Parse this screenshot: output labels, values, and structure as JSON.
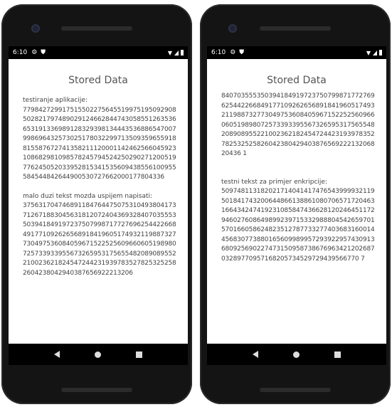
{
  "left": {
    "status": {
      "time": "6:10"
    },
    "title": "Stored Data",
    "sections": [
      {
        "label": "testiranje aplikacije:",
        "value": "779842729917515502275645519975195092908502821797489029124662844743058551263536653191336989128329398134443536886547007998696432573025178032299713509359655918815587672741358211120001142462566045923108682981098578245794524250290271200519776245052033952815341535609438556100955584544842644900530727662000177804336"
      },
      {
        "label": "malo duzi tekst mozda uspijem napisati:",
        "value": "3756317047468911847644750753104938041737126718830456318120724043693284070355535039418491972375079987177276962544226684917710926265689184196051749321198873277304975360840596715225256096606051989807257339339556732659531756554820890895522100236218245472442319397835278253252582604238042940387656922213206"
      }
    ]
  },
  "right": {
    "status": {
      "time": "6:10"
    },
    "title": "Stored Data",
    "sections": [
      {
        "label": "",
        "value": "84070355535039418491972375079987177276962544226684917710926265689184196051749321198873277304975360840596715225256096606051989807257339339556732659531756554820890895522100236218245472442319397835278253252582604238042940387656922213206820436 1"
      },
      {
        "label": "testni tekst za primjer enkripcije:",
        "value": "50974811318202171404141747654399993211950184174320064486613886108070657172046316643424741923108584743662812024645117294602760864989923971533298880454265970157016605862482351278773327740368316001445683077388016560998995729392295743091368092569022747315095873867696342120268703289770957168205734529729439566770 7"
      }
    ]
  }
}
